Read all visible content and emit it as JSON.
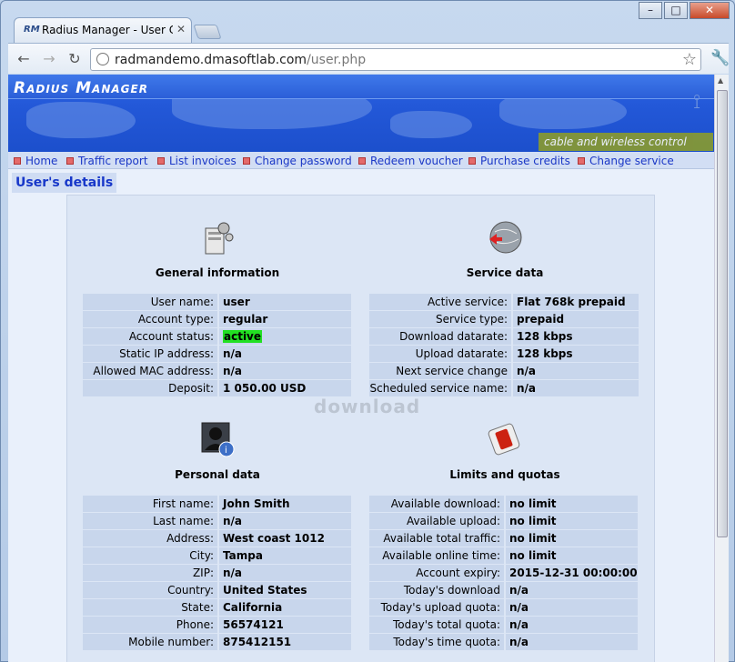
{
  "browser": {
    "tab_title": "Radius Manager - User Con",
    "tab_favicon": "RM",
    "url_host": "radmandemo.dmasoftlab.com",
    "url_path": "/user.php"
  },
  "banner": {
    "logo": "Radius Manager",
    "tagline": "cable and wireless control"
  },
  "menu": [
    {
      "label": "Home"
    },
    {
      "label": "Traffic report"
    },
    {
      "label": "List invoices"
    },
    {
      "label": "Change password"
    },
    {
      "label": "Redeem voucher"
    },
    {
      "label": "Purchase credits"
    },
    {
      "label": "Change service"
    }
  ],
  "page_title": "User's details",
  "sections": {
    "general": {
      "title": "General information",
      "rows": [
        {
          "label": "User name:",
          "value": "user"
        },
        {
          "label": "Account type:",
          "value": "regular"
        },
        {
          "label": "Account status:",
          "value": "active"
        },
        {
          "label": "Static IP address:",
          "value": "n/a"
        },
        {
          "label": "Allowed MAC address:",
          "value": "n/a"
        },
        {
          "label": "Deposit:",
          "value": "1 050.00 USD"
        }
      ]
    },
    "service": {
      "title": "Service data",
      "rows": [
        {
          "label": "Active service:",
          "value": "Flat 768k prepaid"
        },
        {
          "label": "Service type:",
          "value": "prepaid"
        },
        {
          "label": "Download datarate:",
          "value": "128 kbps"
        },
        {
          "label": "Upload datarate:",
          "value": "128 kbps"
        },
        {
          "label": "Next service change date:",
          "value": "n/a"
        },
        {
          "label": "Scheduled service name:",
          "value": "n/a"
        }
      ]
    },
    "personal": {
      "title": "Personal data",
      "rows": [
        {
          "label": "First name:",
          "value": "John Smith"
        },
        {
          "label": "Last name:",
          "value": "n/a"
        },
        {
          "label": "Address:",
          "value": "West coast 1012"
        },
        {
          "label": "City:",
          "value": "Tampa"
        },
        {
          "label": "ZIP:",
          "value": "n/a"
        },
        {
          "label": "Country:",
          "value": "United States"
        },
        {
          "label": "State:",
          "value": "California"
        },
        {
          "label": "Phone:",
          "value": "56574121"
        },
        {
          "label": "Mobile number:",
          "value": "875412151"
        }
      ]
    },
    "limits": {
      "title": "Limits and quotas",
      "rows": [
        {
          "label": "Available download:",
          "value": "no limit"
        },
        {
          "label": "Available upload:",
          "value": "no limit"
        },
        {
          "label": "Available total traffic:",
          "value": "no limit"
        },
        {
          "label": "Available online time:",
          "value": "no limit"
        },
        {
          "label": "Account expiry:",
          "value": "2015-12-31 00:00:00"
        },
        {
          "label": "Today's download quota:",
          "value": "n/a"
        },
        {
          "label": "Today's upload quota:",
          "value": "n/a"
        },
        {
          "label": "Today's total quota:",
          "value": "n/a"
        },
        {
          "label": "Today's time quota:",
          "value": "n/a"
        }
      ]
    }
  },
  "watermark": "download",
  "colors": {
    "active_status": "#22e022",
    "link": "#1a37c6"
  }
}
